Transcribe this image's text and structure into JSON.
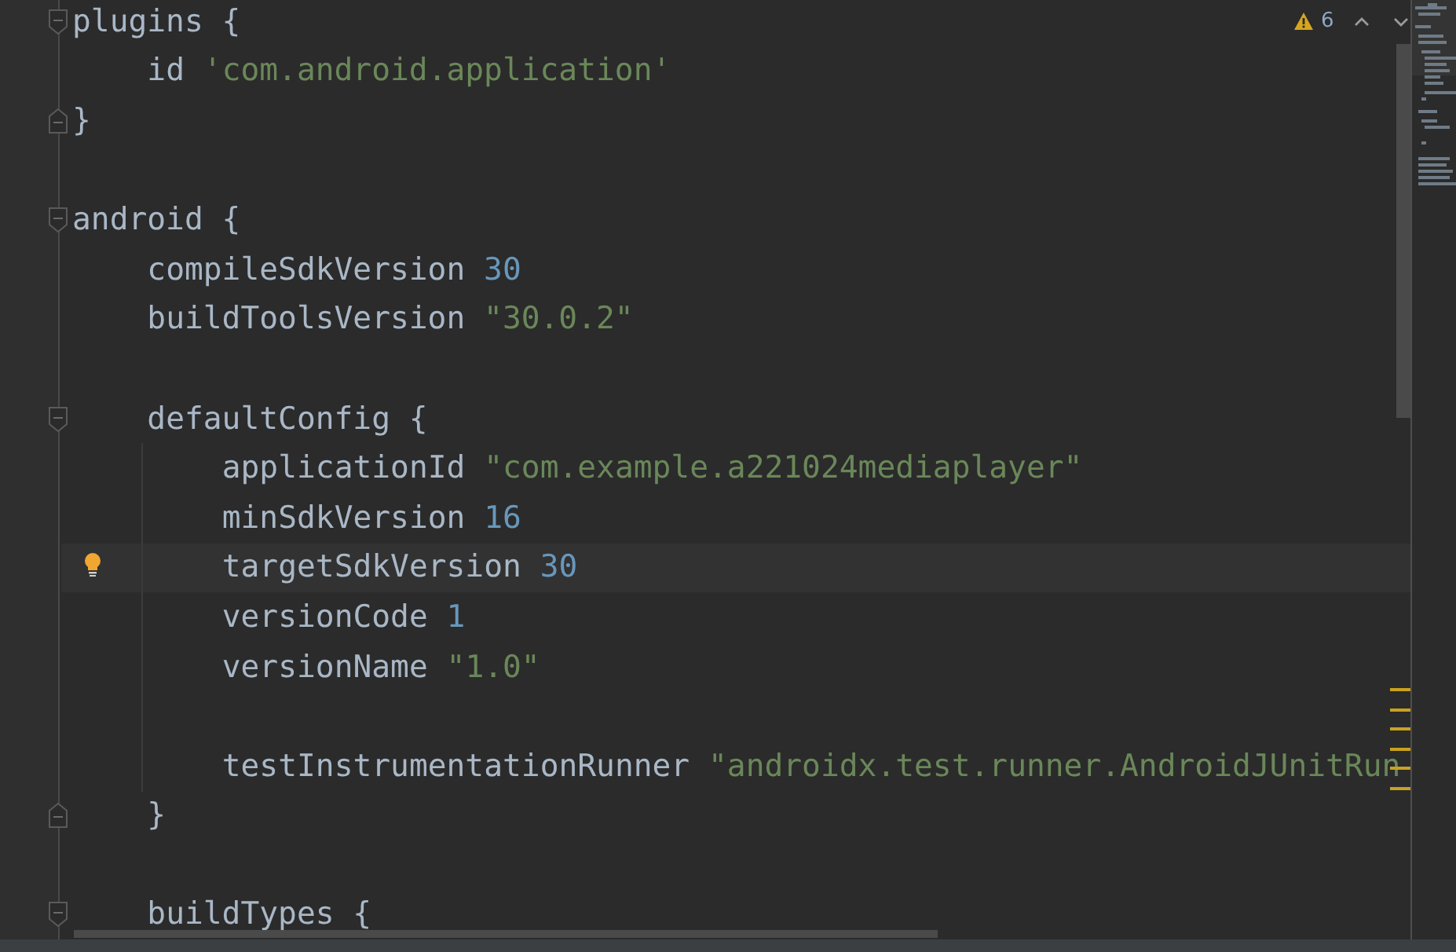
{
  "inspection": {
    "warnings": "6"
  },
  "lines": [
    {
      "fold_start": true,
      "fold_end": false,
      "current": false,
      "tokens": [
        {
          "kind": "plain",
          "text": "plugins {"
        }
      ],
      "children": [
        {
          "fold_start": false,
          "fold_end": false,
          "current": false,
          "tokens": [
            {
              "kind": "plain",
              "text": "id "
            },
            {
              "kind": "string",
              "text": "'com.android.application'"
            }
          ]
        }
      ]
    },
    {
      "fold_start": false,
      "fold_end": true,
      "current": false,
      "tokens": [
        {
          "kind": "plain",
          "text": "}"
        }
      ]
    },
    {
      "fold_start": false,
      "fold_end": false,
      "current": false
    },
    {
      "fold_start": true,
      "fold_end": false,
      "current": false,
      "tokens": [
        {
          "kind": "plain",
          "text": "android {"
        }
      ],
      "children": [
        {
          "fold_start": false,
          "fold_end": false,
          "current": false,
          "tokens": [
            {
              "kind": "plain",
              "text": "compileSdkVersion "
            },
            {
              "kind": "number",
              "text": "30"
            }
          ]
        },
        {
          "fold_start": false,
          "fold_end": false,
          "current": false,
          "tokens": [
            {
              "kind": "plain",
              "text": "buildToolsVersion "
            },
            {
              "kind": "string",
              "text": "\"30.0.2\""
            }
          ]
        },
        {
          "fold_start": false,
          "fold_end": false,
          "current": false
        },
        {
          "fold_start": true,
          "fold_end": false,
          "current": false,
          "tokens": [
            {
              "kind": "plain",
              "text": "defaultConfig {"
            }
          ],
          "children": [
            {
              "fold_start": false,
              "fold_end": false,
              "current": false,
              "tokens": [
                {
                  "kind": "plain",
                  "text": "applicationId "
                },
                {
                  "kind": "string",
                  "text": "\"com.example.a221024mediaplayer\""
                }
              ]
            },
            {
              "fold_start": false,
              "fold_end": false,
              "current": false,
              "tokens": [
                {
                  "kind": "plain",
                  "text": "minSdkVersion "
                },
                {
                  "kind": "number",
                  "text": "16"
                }
              ]
            },
            {
              "fold_start": false,
              "fold_end": false,
              "current": true,
              "tokens": [
                {
                  "kind": "plain",
                  "text": "targetSdkVersion "
                },
                {
                  "kind": "number",
                  "text": "30"
                }
              ]
            },
            {
              "fold_start": false,
              "fold_end": false,
              "current": false,
              "tokens": [
                {
                  "kind": "plain",
                  "text": "versionCode "
                },
                {
                  "kind": "number",
                  "text": "1"
                }
              ]
            },
            {
              "fold_start": false,
              "fold_end": false,
              "current": false,
              "tokens": [
                {
                  "kind": "plain",
                  "text": "versionName "
                },
                {
                  "kind": "string",
                  "text": "\"1.0\""
                }
              ]
            },
            {
              "fold_start": false,
              "fold_end": false,
              "current": false
            },
            {
              "fold_start": false,
              "fold_end": false,
              "current": false,
              "tokens": [
                {
                  "kind": "plain",
                  "text": "testInstrumentationRunner "
                },
                {
                  "kind": "string",
                  "text": "\"androidx.test.runner.AndroidJUnitRun"
                }
              ]
            }
          ]
        },
        {
          "fold_start": false,
          "fold_end": true,
          "current": false,
          "tokens": [
            {
              "kind": "plain",
              "text": "}"
            }
          ]
        },
        {
          "fold_start": false,
          "fold_end": false,
          "current": false
        },
        {
          "fold_start": true,
          "fold_end": false,
          "current": false,
          "tokens": [
            {
              "kind": "plain",
              "text": "buildTypes {"
            }
          ]
        }
      ]
    }
  ]
}
